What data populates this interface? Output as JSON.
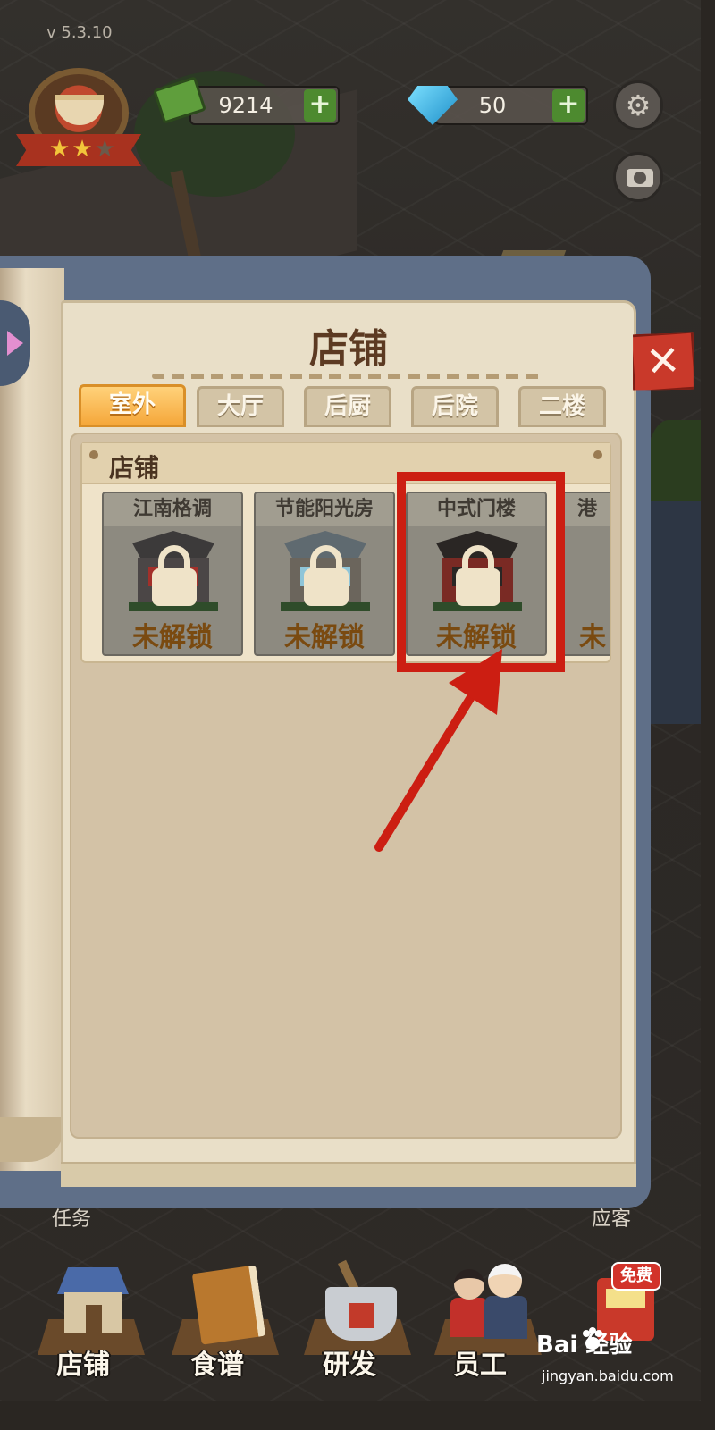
{
  "app": {
    "version": "v 5.3.10"
  },
  "hud": {
    "cash": "9214",
    "gems": "50",
    "plus": "+",
    "stars_on": "★★",
    "stars_off": "★",
    "gear_glyph": "⚙"
  },
  "shop_panel": {
    "title": "店铺",
    "close_glyph": "✕",
    "tabs": [
      {
        "label": "室外",
        "active": true
      },
      {
        "label": "大厅",
        "active": false
      },
      {
        "label": "后厨",
        "active": false
      },
      {
        "label": "后院",
        "active": false
      },
      {
        "label": "二楼",
        "active": false
      }
    ],
    "section_title": "店铺",
    "items": [
      {
        "name": "江南格调",
        "status": "未解锁",
        "style": "jiangnan"
      },
      {
        "name": "节能阳光房",
        "status": "未解锁",
        "style": "sun"
      },
      {
        "name": "中式门楼",
        "status": "未解锁",
        "style": "chinese"
      },
      {
        "name": "港",
        "status": "未",
        "style": "partial"
      }
    ]
  },
  "background_labels": {
    "tasks": "任务",
    "right_label": "应客"
  },
  "bottom_nav": [
    {
      "label": "店铺",
      "icon": "shop-building-icon"
    },
    {
      "label": "食谱",
      "icon": "recipe-book-icon"
    },
    {
      "label": "研发",
      "icon": "cooking-pot-icon"
    },
    {
      "label": "员工",
      "icon": "staff-icon"
    },
    {
      "label": "",
      "icon": "vending-machine-icon"
    }
  ],
  "free_tag": "免费",
  "watermark": {
    "brand": "Bai  经验",
    "url": "jingyan.baidu.com"
  },
  "colors": {
    "highlight": "#cc1e12",
    "active_tab": "#f5a83b",
    "locked_text": "#7a4a10"
  }
}
